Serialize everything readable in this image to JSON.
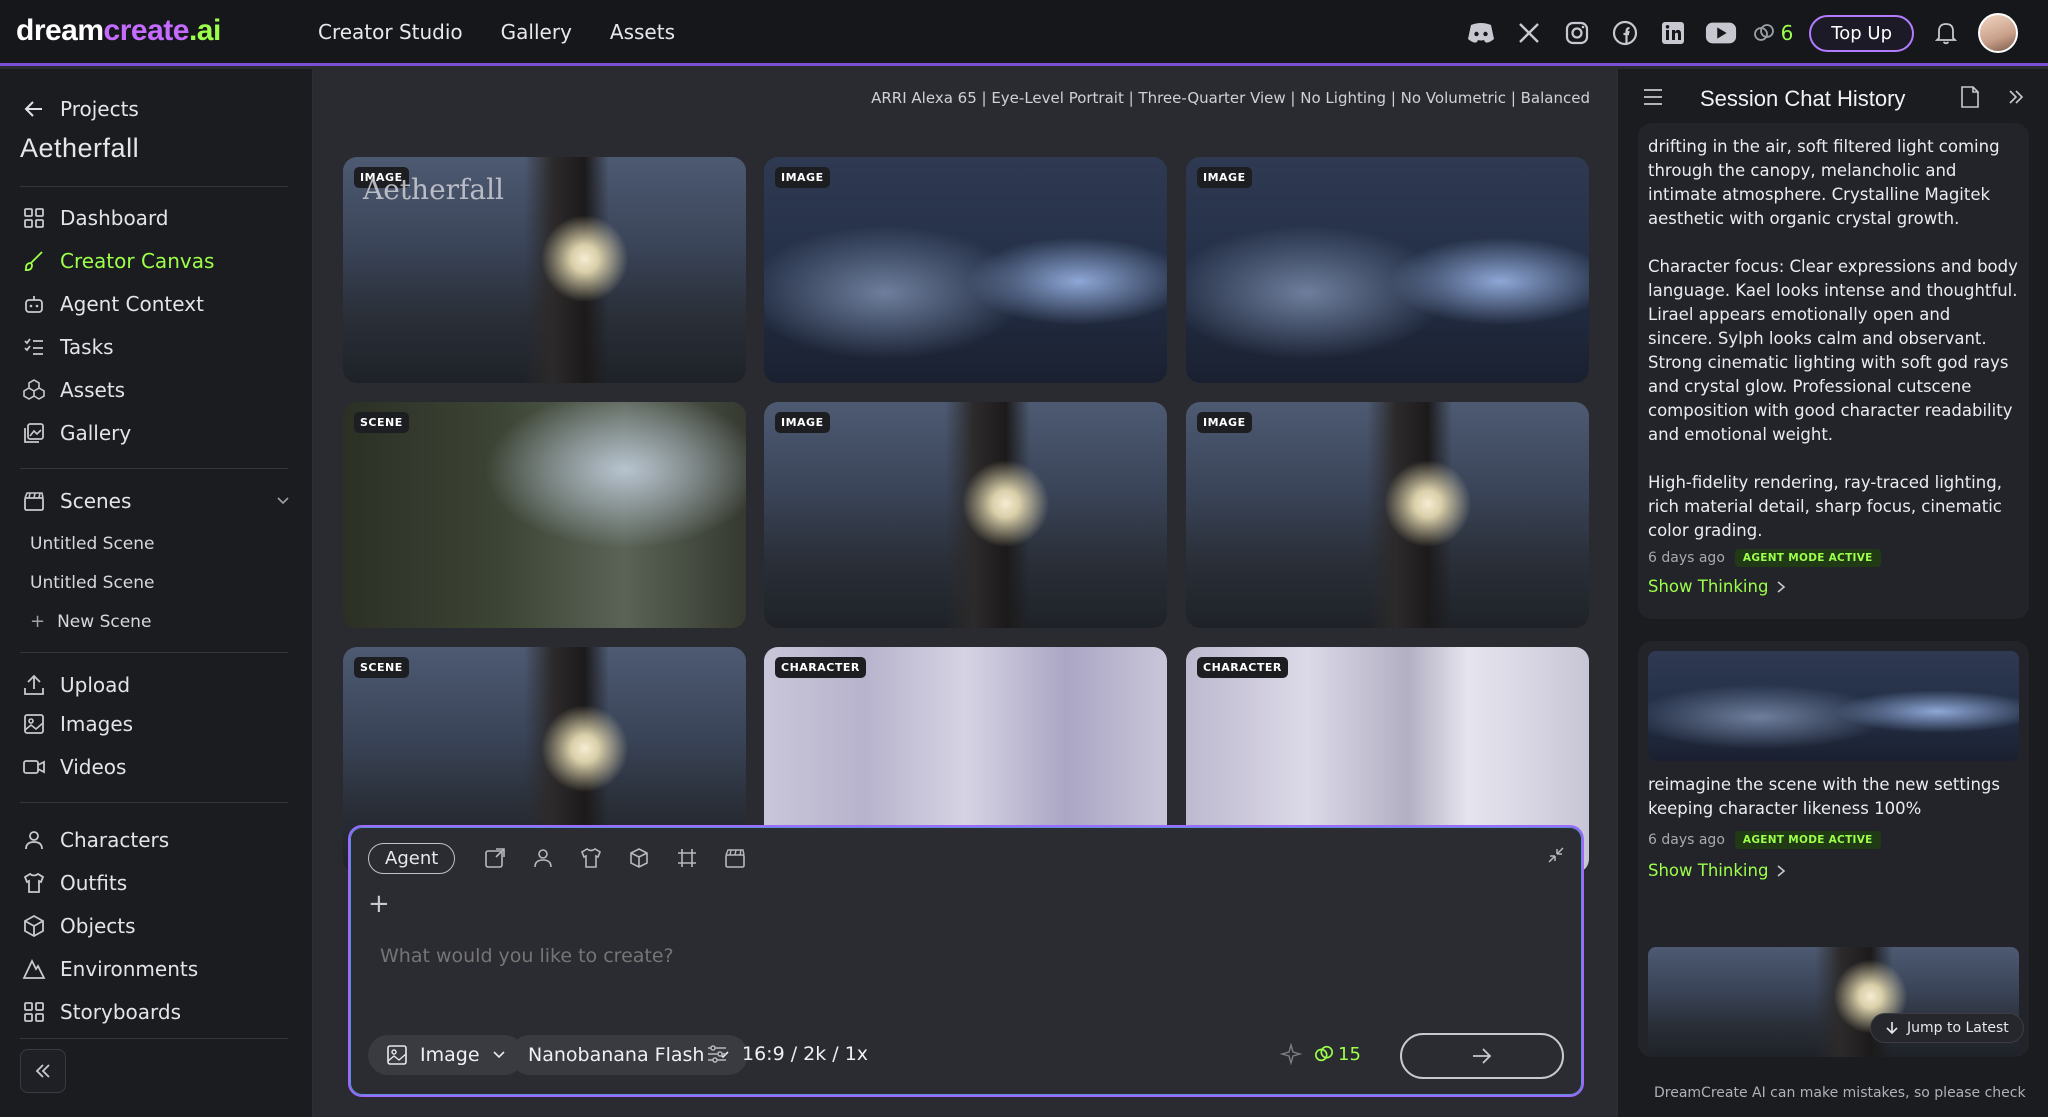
{
  "brand": {
    "part1": "dream",
    "part2": "create",
    "part3": ".ai"
  },
  "topnav": [
    "Creator Studio",
    "Gallery",
    "Assets"
  ],
  "topbar": {
    "credits": "6",
    "topup_label": "Top Up"
  },
  "sidebar": {
    "back_label": "Projects",
    "project_name": "Aetherfall",
    "main_items": [
      {
        "label": "Dashboard",
        "icon": "grid-icon"
      },
      {
        "label": "Creator Canvas",
        "icon": "brush-icon",
        "active": true
      },
      {
        "label": "Agent Context",
        "icon": "robot-icon"
      },
      {
        "label": "Tasks",
        "icon": "checklist-icon"
      },
      {
        "label": "Assets",
        "icon": "cubes-icon"
      },
      {
        "label": "Gallery",
        "icon": "image-gallery-icon"
      }
    ],
    "scenes_label": "Scenes",
    "scenes": [
      "Untitled Scene",
      "Untitled Scene"
    ],
    "new_scene_label": "New Scene",
    "media_items": [
      {
        "label": "Upload",
        "icon": "upload-icon"
      },
      {
        "label": "Images",
        "icon": "image-icon"
      },
      {
        "label": "Videos",
        "icon": "video-icon"
      }
    ],
    "library_items": [
      {
        "label": "Characters",
        "icon": "person-icon"
      },
      {
        "label": "Outfits",
        "icon": "shirt-icon"
      },
      {
        "label": "Objects",
        "icon": "box-icon"
      },
      {
        "label": "Environments",
        "icon": "mountain-icon"
      },
      {
        "label": "Storyboards",
        "icon": "storyboard-icon"
      }
    ]
  },
  "settings_bar": "ARRI Alexa 65  |  Eye-Level Portrait  |  Three-Quarter View  |  No Lighting  |  No Volumetric  |  Balanced",
  "gallery": {
    "cards": [
      {
        "tag": "IMAGE",
        "overlay": "Aetherfall"
      },
      {
        "tag": "IMAGE"
      },
      {
        "tag": "IMAGE"
      },
      {
        "tag": "SCENE"
      },
      {
        "tag": "IMAGE"
      },
      {
        "tag": "IMAGE"
      },
      {
        "tag": "SCENE"
      },
      {
        "tag": "CHARACTER"
      },
      {
        "tag": "CHARACTER"
      }
    ]
  },
  "composer": {
    "agent_label": "Agent",
    "placeholder": "What would you like to create?",
    "mode_label": "Image",
    "model_label": "Nanobanana Flash",
    "ratio_label": "16:9 / 2k / 1x",
    "cost": "15"
  },
  "chat": {
    "title": "Session Chat History",
    "msg1": {
      "paragraphs": [
        "drifting in the air, soft filtered light coming through the canopy, melancholic and intimate atmosphere. Crystalline Magitek aesthetic with organic crystal growth.",
        "Character focus: Clear expressions and body language. Kael looks intense and thoughtful. Lirael appears emotionally open and sincere. Sylph looks calm and observant. Strong cinematic lighting with soft god rays and crystal glow. Professional cutscene composition with good character readability and emotional weight.",
        "High-fidelity rendering, ray-traced lighting, rich material detail, sharp focus, cinematic color grading."
      ],
      "time": "6 days ago",
      "badge": "AGENT MODE ACTIVE",
      "thinking": "Show Thinking"
    },
    "msg2": {
      "text": "reimagine the scene with the new settings keeping character likeness 100%",
      "time": "6 days ago",
      "badge": "AGENT MODE ACTIVE",
      "thinking": "Show Thinking"
    },
    "jump_label": "Jump to Latest",
    "disclaimer": "DreamCreate AI can make mistakes, so please check"
  }
}
